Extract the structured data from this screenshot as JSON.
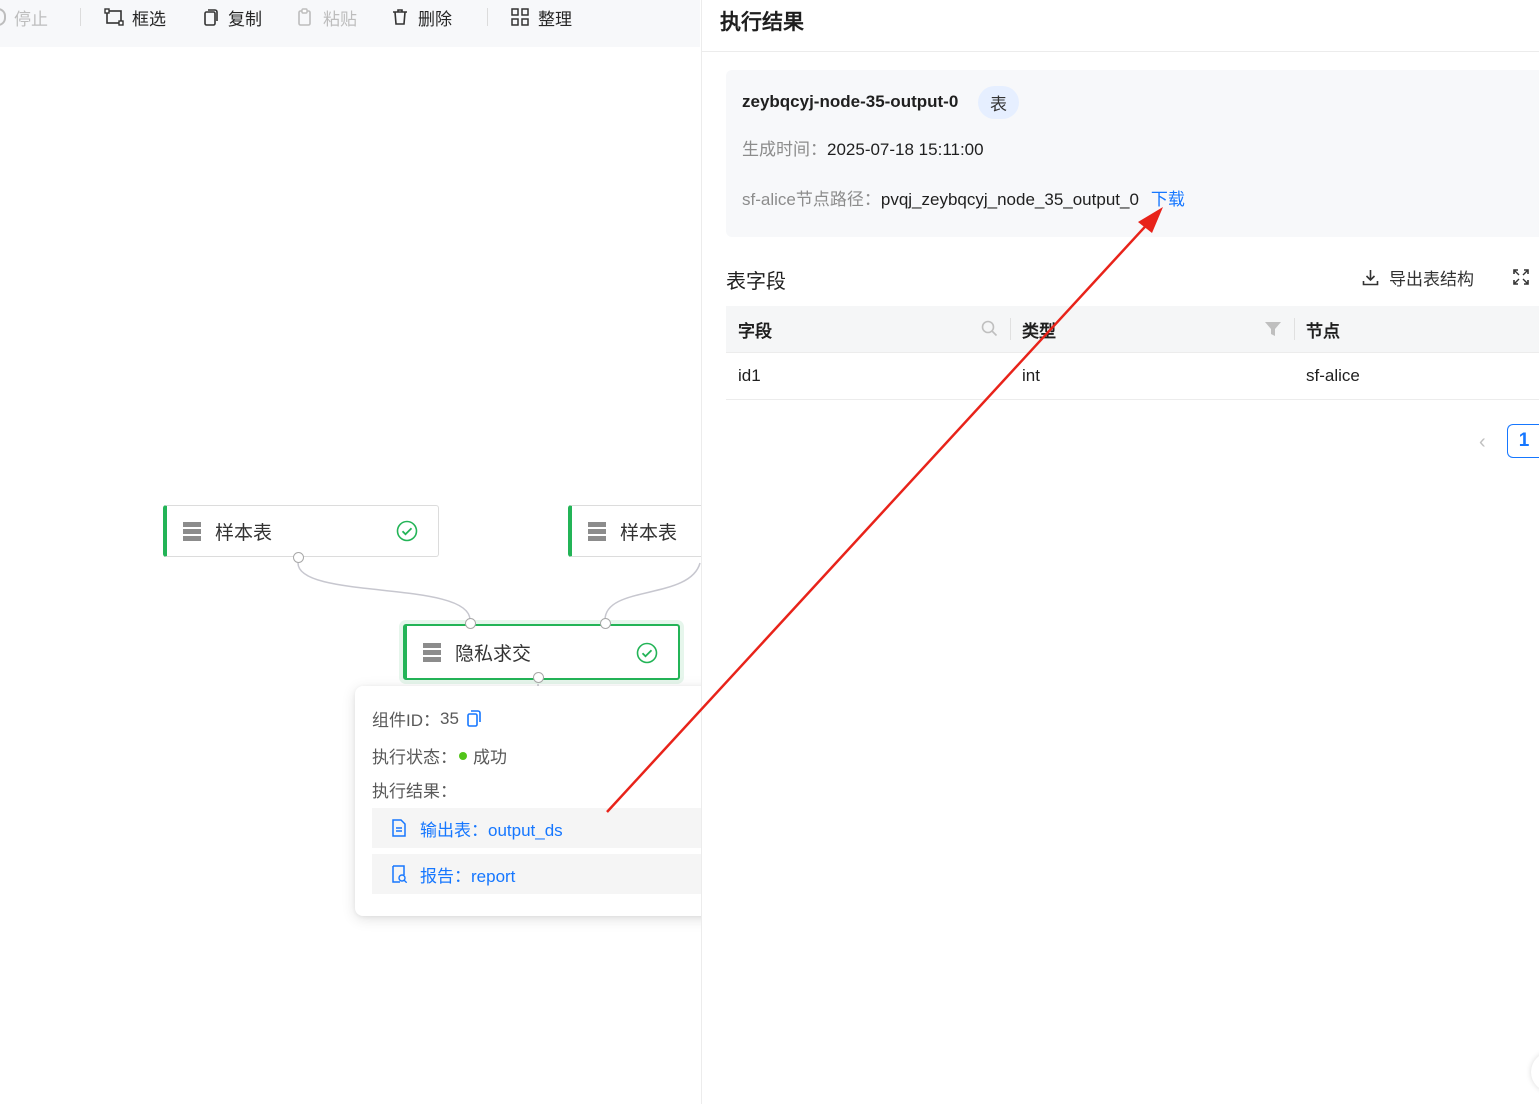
{
  "toolbar": {
    "stop": "停止",
    "select": "框选",
    "copy": "复制",
    "paste": "粘贴",
    "delete": "删除",
    "arrange": "整理"
  },
  "canvas": {
    "nodes": [
      {
        "label": "样本表",
        "status": "success"
      },
      {
        "label": "样本表",
        "status": "success"
      },
      {
        "label": "隐私求交",
        "status": "success"
      }
    ]
  },
  "popover": {
    "component_id_label": "组件ID：",
    "component_id": "35",
    "status_label": "执行状态：",
    "status_value": "成功",
    "result_label": "执行结果：",
    "output_table": "输出表：output_ds",
    "report": "报告：report"
  },
  "drawer": {
    "title": "执行结果",
    "output_name": "zeybqcyj-node-35-output-0",
    "tag": "表",
    "time_label": "生成时间：",
    "time_value": "2025-07-18 15:11:00",
    "path_label": "sf-alice节点路径：",
    "path_value": "pvqj_zeybqcyj_node_35_output_0",
    "download": "下载",
    "fields_title": "表字段",
    "export_label": "导出表结构",
    "table": {
      "headers": [
        "字段",
        "类型",
        "节点"
      ],
      "rows": [
        [
          "id1",
          "int",
          "sf-alice"
        ]
      ]
    },
    "pager": {
      "current": "1"
    }
  },
  "colors": {
    "accent": "#1677ff",
    "success": "#23b457",
    "annotation_arrow": "#e8231a"
  }
}
